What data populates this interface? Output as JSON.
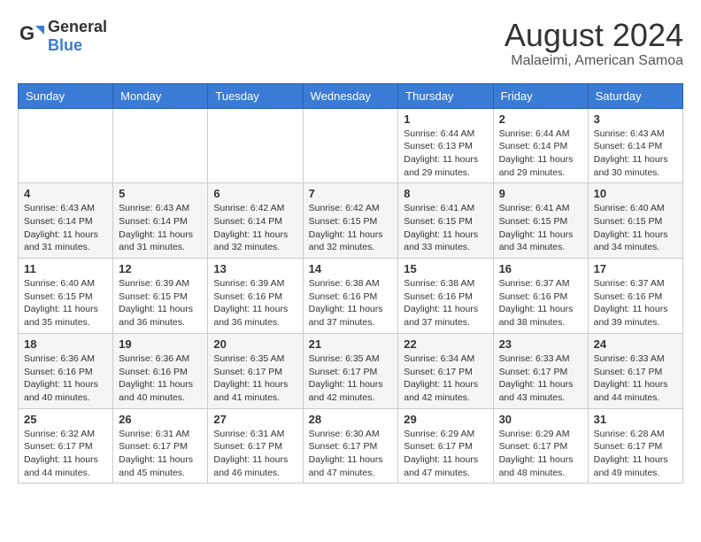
{
  "logo": {
    "general": "General",
    "blue": "Blue"
  },
  "header": {
    "month_year": "August 2024",
    "location": "Malaeimi, American Samoa"
  },
  "weekdays": [
    "Sunday",
    "Monday",
    "Tuesday",
    "Wednesday",
    "Thursday",
    "Friday",
    "Saturday"
  ],
  "weeks": [
    [
      {
        "day": "",
        "info": ""
      },
      {
        "day": "",
        "info": ""
      },
      {
        "day": "",
        "info": ""
      },
      {
        "day": "",
        "info": ""
      },
      {
        "day": "1",
        "info": "Sunrise: 6:44 AM\nSunset: 6:13 PM\nDaylight: 11 hours\nand 29 minutes."
      },
      {
        "day": "2",
        "info": "Sunrise: 6:44 AM\nSunset: 6:14 PM\nDaylight: 11 hours\nand 29 minutes."
      },
      {
        "day": "3",
        "info": "Sunrise: 6:43 AM\nSunset: 6:14 PM\nDaylight: 11 hours\nand 30 minutes."
      }
    ],
    [
      {
        "day": "4",
        "info": "Sunrise: 6:43 AM\nSunset: 6:14 PM\nDaylight: 11 hours\nand 31 minutes."
      },
      {
        "day": "5",
        "info": "Sunrise: 6:43 AM\nSunset: 6:14 PM\nDaylight: 11 hours\nand 31 minutes."
      },
      {
        "day": "6",
        "info": "Sunrise: 6:42 AM\nSunset: 6:14 PM\nDaylight: 11 hours\nand 32 minutes."
      },
      {
        "day": "7",
        "info": "Sunrise: 6:42 AM\nSunset: 6:15 PM\nDaylight: 11 hours\nand 32 minutes."
      },
      {
        "day": "8",
        "info": "Sunrise: 6:41 AM\nSunset: 6:15 PM\nDaylight: 11 hours\nand 33 minutes."
      },
      {
        "day": "9",
        "info": "Sunrise: 6:41 AM\nSunset: 6:15 PM\nDaylight: 11 hours\nand 34 minutes."
      },
      {
        "day": "10",
        "info": "Sunrise: 6:40 AM\nSunset: 6:15 PM\nDaylight: 11 hours\nand 34 minutes."
      }
    ],
    [
      {
        "day": "11",
        "info": "Sunrise: 6:40 AM\nSunset: 6:15 PM\nDaylight: 11 hours\nand 35 minutes."
      },
      {
        "day": "12",
        "info": "Sunrise: 6:39 AM\nSunset: 6:15 PM\nDaylight: 11 hours\nand 36 minutes."
      },
      {
        "day": "13",
        "info": "Sunrise: 6:39 AM\nSunset: 6:16 PM\nDaylight: 11 hours\nand 36 minutes."
      },
      {
        "day": "14",
        "info": "Sunrise: 6:38 AM\nSunset: 6:16 PM\nDaylight: 11 hours\nand 37 minutes."
      },
      {
        "day": "15",
        "info": "Sunrise: 6:38 AM\nSunset: 6:16 PM\nDaylight: 11 hours\nand 37 minutes."
      },
      {
        "day": "16",
        "info": "Sunrise: 6:37 AM\nSunset: 6:16 PM\nDaylight: 11 hours\nand 38 minutes."
      },
      {
        "day": "17",
        "info": "Sunrise: 6:37 AM\nSunset: 6:16 PM\nDaylight: 11 hours\nand 39 minutes."
      }
    ],
    [
      {
        "day": "18",
        "info": "Sunrise: 6:36 AM\nSunset: 6:16 PM\nDaylight: 11 hours\nand 40 minutes."
      },
      {
        "day": "19",
        "info": "Sunrise: 6:36 AM\nSunset: 6:16 PM\nDaylight: 11 hours\nand 40 minutes."
      },
      {
        "day": "20",
        "info": "Sunrise: 6:35 AM\nSunset: 6:17 PM\nDaylight: 11 hours\nand 41 minutes."
      },
      {
        "day": "21",
        "info": "Sunrise: 6:35 AM\nSunset: 6:17 PM\nDaylight: 11 hours\nand 42 minutes."
      },
      {
        "day": "22",
        "info": "Sunrise: 6:34 AM\nSunset: 6:17 PM\nDaylight: 11 hours\nand 42 minutes."
      },
      {
        "day": "23",
        "info": "Sunrise: 6:33 AM\nSunset: 6:17 PM\nDaylight: 11 hours\nand 43 minutes."
      },
      {
        "day": "24",
        "info": "Sunrise: 6:33 AM\nSunset: 6:17 PM\nDaylight: 11 hours\nand 44 minutes."
      }
    ],
    [
      {
        "day": "25",
        "info": "Sunrise: 6:32 AM\nSunset: 6:17 PM\nDaylight: 11 hours\nand 44 minutes."
      },
      {
        "day": "26",
        "info": "Sunrise: 6:31 AM\nSunset: 6:17 PM\nDaylight: 11 hours\nand 45 minutes."
      },
      {
        "day": "27",
        "info": "Sunrise: 6:31 AM\nSunset: 6:17 PM\nDaylight: 11 hours\nand 46 minutes."
      },
      {
        "day": "28",
        "info": "Sunrise: 6:30 AM\nSunset: 6:17 PM\nDaylight: 11 hours\nand 47 minutes."
      },
      {
        "day": "29",
        "info": "Sunrise: 6:29 AM\nSunset: 6:17 PM\nDaylight: 11 hours\nand 47 minutes."
      },
      {
        "day": "30",
        "info": "Sunrise: 6:29 AM\nSunset: 6:17 PM\nDaylight: 11 hours\nand 48 minutes."
      },
      {
        "day": "31",
        "info": "Sunrise: 6:28 AM\nSunset: 6:17 PM\nDaylight: 11 hours\nand 49 minutes."
      }
    ]
  ]
}
